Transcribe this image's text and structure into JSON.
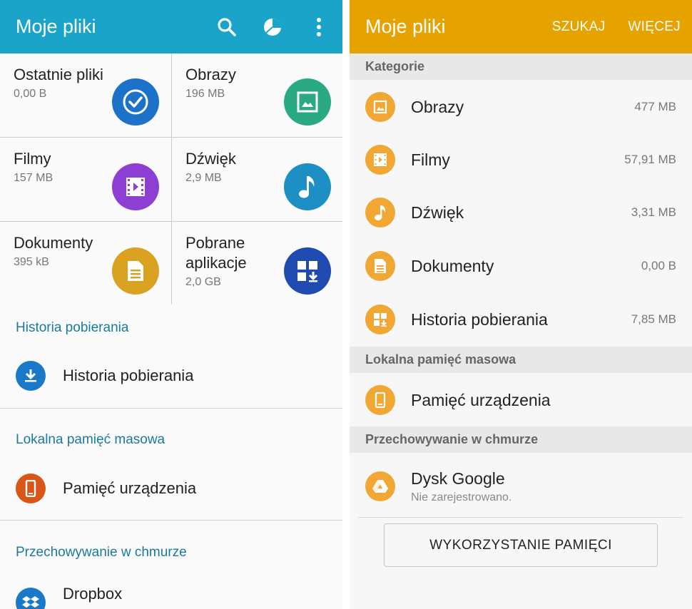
{
  "left": {
    "title": "Moje pliki",
    "header_color": "#1aa4c9",
    "icons": [
      "search-icon",
      "storage-pie-icon",
      "more-vert-icon"
    ],
    "tiles": [
      {
        "name": "Ostatnie pliki",
        "size": "0,00 B",
        "icon": "recent-clock-icon",
        "color": "#1c72c9"
      },
      {
        "name": "Obrazy",
        "size": "196 MB",
        "icon": "image-icon",
        "color": "#2aaa84"
      },
      {
        "name": "Filmy",
        "size": "157 MB",
        "icon": "video-icon",
        "color": "#8d3fd4"
      },
      {
        "name": "Dźwięk",
        "size": "2,9 MB",
        "icon": "music-note-icon",
        "color": "#1e8fc4"
      },
      {
        "name": "Dokumenty",
        "size": "395 kB",
        "icon": "document-icon",
        "color": "#d9a220"
      },
      {
        "name": "Pobrane aplikacje",
        "size": "2,0 GB",
        "icon": "apps-download-icon",
        "color": "#1f4bb0"
      }
    ],
    "sections": {
      "downloads": {
        "header": "Historia pobierania",
        "item": "Historia pobierania",
        "icon_color": "#1a78c8"
      },
      "local": {
        "header": "Lokalna pamięć masowa",
        "item": "Pamięć urządzenia",
        "icon_color": "#d95618"
      },
      "cloud": {
        "header": "Przechowywanie w chmurze",
        "item": "Dropbox",
        "icon_color": "#1a78c8"
      }
    }
  },
  "right": {
    "title": "Moje pliki",
    "header_color": "#e6a300",
    "search_label": "SZUKAJ",
    "more_label": "WIĘCEJ",
    "categories_header": "Kategorie",
    "categories": [
      {
        "name": "Obrazy",
        "size": "477 MB",
        "icon": "image-icon"
      },
      {
        "name": "Filmy",
        "size": "57,91 MB",
        "icon": "video-icon"
      },
      {
        "name": "Dźwięk",
        "size": "3,31 MB",
        "icon": "music-note-icon"
      },
      {
        "name": "Dokumenty",
        "size": "0,00 B",
        "icon": "document-icon"
      },
      {
        "name": "Historia pobierania",
        "size": "7,85 MB",
        "icon": "apps-download-icon"
      }
    ],
    "local_header": "Lokalna pamięć masowa",
    "local_item": "Pamięć urządzenia",
    "cloud_header": "Przechowywanie w chmurze",
    "cloud_item": "Dysk Google",
    "cloud_sub": "Nie zarejestrowano.",
    "button_label": "WYKORZYSTANIE PAMIĘCI"
  }
}
